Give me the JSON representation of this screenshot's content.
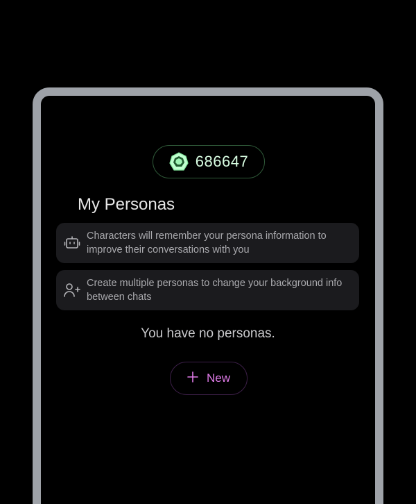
{
  "coins": {
    "value": "686647",
    "icon": "gem-coin-icon",
    "accent": "#9ff5b5"
  },
  "page": {
    "title": "My Personas"
  },
  "info_cards": [
    {
      "icon": "robot-icon",
      "text": "Characters will remember your persona information to improve their conversations with you"
    },
    {
      "icon": "add-user-icon",
      "text": "Create multiple personas to change your background info between chats"
    }
  ],
  "empty_state": {
    "text": "You have no personas."
  },
  "new_button": {
    "label": "New",
    "icon": "plus-icon",
    "color": "#e07be8"
  }
}
